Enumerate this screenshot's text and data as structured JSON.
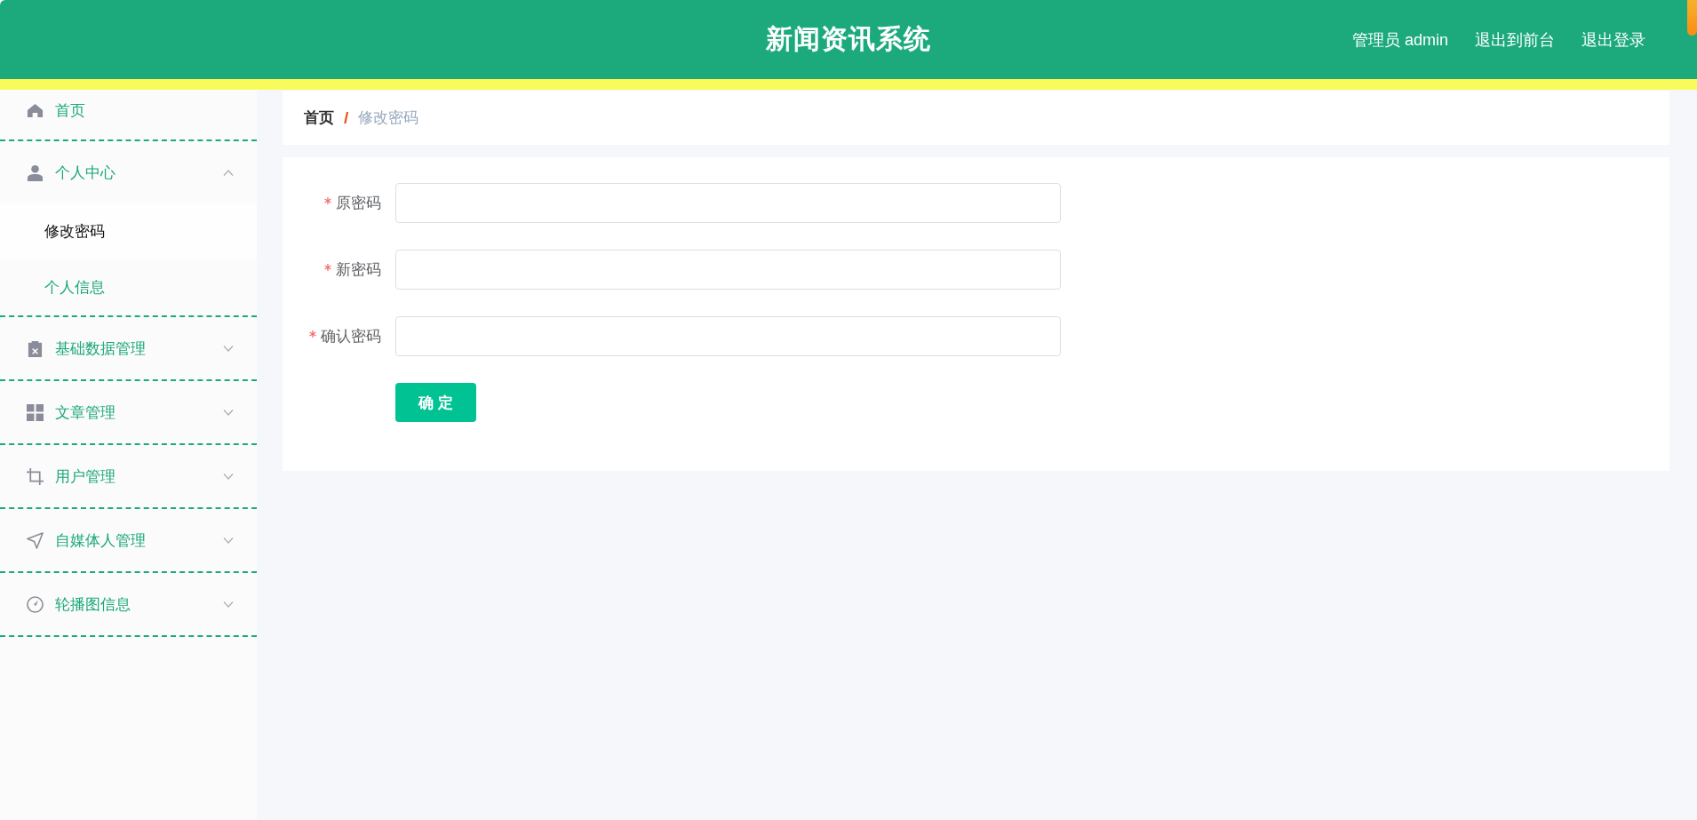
{
  "header": {
    "title": "新闻资讯系统",
    "user": "管理员 admin",
    "actions": [
      "退出到前台",
      "退出登录"
    ]
  },
  "sidebar": {
    "items": [
      {
        "label": "首页",
        "kind": "link",
        "selected": false
      },
      {
        "label": "个人中心",
        "kind": "submenu",
        "selected": false,
        "expanded": true,
        "children": [
          {
            "label": "修改密码",
            "selected": true
          },
          {
            "label": "个人信息",
            "selected": false
          }
        ]
      },
      {
        "label": "基础数据管理",
        "kind": "submenu",
        "selected": false,
        "expanded": false
      },
      {
        "label": "文章管理",
        "kind": "submenu",
        "selected": false,
        "expanded": false
      },
      {
        "label": "用户管理",
        "kind": "submenu",
        "selected": false,
        "expanded": false
      },
      {
        "label": "自媒体人管理",
        "kind": "submenu",
        "selected": false,
        "expanded": false
      },
      {
        "label": "轮播图信息",
        "kind": "submenu",
        "selected": false,
        "expanded": false
      }
    ]
  },
  "breadcrumb": {
    "separator": "/",
    "items": [
      {
        "label": "首页",
        "current": false
      },
      {
        "label": "修改密码",
        "current": true
      }
    ]
  },
  "form": {
    "fields": [
      {
        "label": "原密码",
        "required": true
      },
      {
        "label": "新密码",
        "required": true
      },
      {
        "label": "确认密码",
        "required": true
      }
    ],
    "submit": "确 定"
  }
}
